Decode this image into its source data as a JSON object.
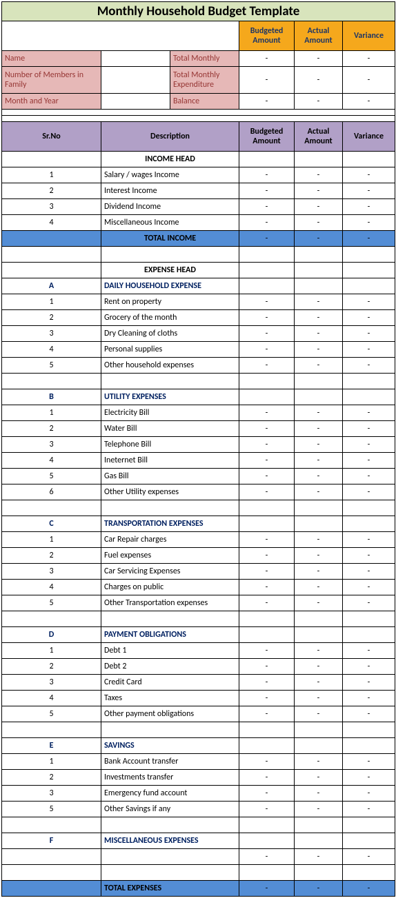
{
  "title": "Monthly Household Budget Template",
  "header1": {
    "budgeted": "Budgeted Amount",
    "actual": "Actual Amount",
    "variance": "Variance"
  },
  "summary": {
    "nameLabel": "Name",
    "familyLabel": "Number of Members in Family",
    "monthLabel": "Month and Year",
    "totalMonthly": "Total Monthly",
    "totalExp": "Total Monthly Expenditure",
    "balance": "Balance"
  },
  "header2": {
    "srno": "Sr.No",
    "desc": "Description",
    "budgeted": "Budgeted Amount",
    "actual": "Actual Amount",
    "variance": "Variance"
  },
  "incomeHead": "INCOME HEAD",
  "income": [
    {
      "n": "1",
      "d": "Salary / wages Income"
    },
    {
      "n": "2",
      "d": "Interest Income"
    },
    {
      "n": "3",
      "d": "Dividend Income"
    },
    {
      "n": "4",
      "d": "Miscellaneous Income"
    }
  ],
  "totalIncome": "TOTAL INCOME",
  "expenseHead": "EXPENSE HEAD",
  "secA": {
    "id": "A",
    "name": "DAILY HOUSEHOLD EXPENSE",
    "items": [
      {
        "n": "1",
        "d": "Rent on property"
      },
      {
        "n": "2",
        "d": "Grocery of the month"
      },
      {
        "n": "3",
        "d": "Dry Cleaning of cloths"
      },
      {
        "n": "4",
        "d": "Personal supplies"
      },
      {
        "n": "5",
        "d": "Other household expenses"
      }
    ]
  },
  "secB": {
    "id": "B",
    "name": "UTILITY EXPENSES",
    "items": [
      {
        "n": "1",
        "d": "Electricity Bill"
      },
      {
        "n": "2",
        "d": "Water Bill"
      },
      {
        "n": "3",
        "d": "Telephone Bill"
      },
      {
        "n": "4",
        "d": "Ineternet Bill"
      },
      {
        "n": "5",
        "d": "Gas Bill"
      },
      {
        "n": "6",
        "d": "Other Utility expenses"
      }
    ]
  },
  "secC": {
    "id": "C",
    "name": "TRANSPORTATION EXPENSES",
    "items": [
      {
        "n": "1",
        "d": "Car Repair charges"
      },
      {
        "n": "2",
        "d": "Fuel expenses"
      },
      {
        "n": "3",
        "d": "Car Servicing Expenses"
      },
      {
        "n": "4",
        "d": "Charges on public"
      },
      {
        "n": "5",
        "d": "Other Transportation expenses"
      }
    ]
  },
  "secD": {
    "id": "D",
    "name": "PAYMENT OBLIGATIONS",
    "items": [
      {
        "n": "1",
        "d": "Debt 1"
      },
      {
        "n": "2",
        "d": "Debt 2"
      },
      {
        "n": "3",
        "d": "Credit Card"
      },
      {
        "n": "4",
        "d": "Taxes"
      },
      {
        "n": "5",
        "d": "Other payment obligations"
      }
    ]
  },
  "secE": {
    "id": "E",
    "name": "SAVINGS",
    "items": [
      {
        "n": "1",
        "d": "Bank Account transfer"
      },
      {
        "n": "2",
        "d": "Investments transfer"
      },
      {
        "n": "3",
        "d": "Emergency fund account"
      },
      {
        "n": "5",
        "d": "Other Savings if any"
      }
    ]
  },
  "secF": {
    "id": "F",
    "name": "MISCELLANEOUS EXPENSES"
  },
  "totalExpenses": "TOTAL EXPENSES",
  "dash": "-"
}
